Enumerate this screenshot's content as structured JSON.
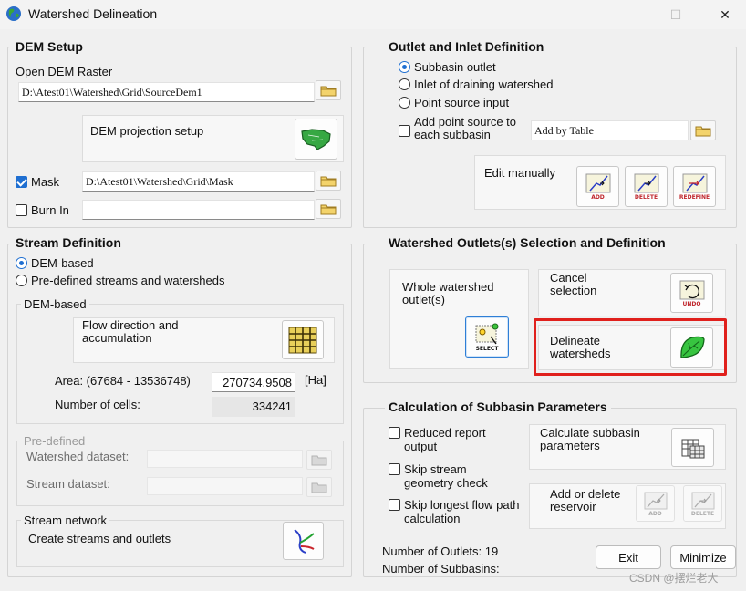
{
  "window": {
    "title": "Watershed Delineation",
    "minimize_glyph": "—",
    "maximize_glyph": "☐",
    "close_glyph": "✕"
  },
  "dem_setup": {
    "title": "DEM Setup",
    "open_raster_label": "Open DEM Raster",
    "dem_path": "D:\\Atest01\\Watershed\\Grid\\SourceDem1",
    "projection_label": "DEM projection setup",
    "mask_label": "Mask",
    "mask_checked": true,
    "mask_path": "D:\\Atest01\\Watershed\\Grid\\Mask",
    "burn_in_label": "Burn In",
    "burn_in_checked": false,
    "burn_in_path": ""
  },
  "stream_definition": {
    "title": "Stream Definition",
    "option_dem": "DEM-based",
    "option_predefined": "Pre-defined streams and watersheds",
    "selected": "dem",
    "dem_based": {
      "title": "DEM-based",
      "flow_label": "Flow direction and accumulation",
      "area_label": "Area: (67684 - 13536748)",
      "area_value": "270734.9508",
      "area_unit": "[Ha]",
      "cells_label": "Number of cells:",
      "cells_value": "334241"
    },
    "predefined": {
      "title": "Pre-defined",
      "watershed_label": "Watershed dataset:",
      "stream_label": "Stream dataset:"
    },
    "network": {
      "title": "Stream network",
      "create_label": "Create streams and outlets"
    }
  },
  "outlet_inlet": {
    "title": "Outlet and Inlet Definition",
    "option_subbasin": "Subbasin outlet",
    "option_inlet": "Inlet of draining watershed",
    "option_point": "Point source input",
    "selected": "subbasin",
    "add_point_label": "Add point source to each subbasin",
    "add_point_checked": false,
    "add_by_table": "Add by Table",
    "edit_manually_label": "Edit manually",
    "icon_add": "ADD",
    "icon_delete": "DELETE",
    "icon_redefine": "REDEFINE"
  },
  "watershed_outlets": {
    "title": "Watershed Outlets(s) Selection and Definition",
    "whole_label": "Whole watershed outlet(s)",
    "icon_select": "SELECT",
    "cancel_label": "Cancel selection",
    "icon_undo": "UNDO",
    "delineate_label": "Delineate watersheds"
  },
  "subbasin_params": {
    "title": "Calculation of Subbasin Parameters",
    "reduced_label": "Reduced  report output",
    "skip_stream_label": "Skip stream geometry check",
    "skip_longest_label": "Skip longest flow path calculation",
    "calc_label": "Calculate subbasin parameters",
    "reservoir_label": "Add or delete reservoir",
    "icon_add": "ADD",
    "icon_delete": "DELETE"
  },
  "footer": {
    "outlets_label": "Number of Outlets: 19",
    "subbasins_label": "Number of Subbasins:",
    "exit_label": "Exit",
    "minimize_label": "Minimize",
    "watermark": "CSDN @摆烂老大"
  },
  "colors": {
    "accent": "#1f6fd1",
    "highlight": "#e0201c"
  }
}
